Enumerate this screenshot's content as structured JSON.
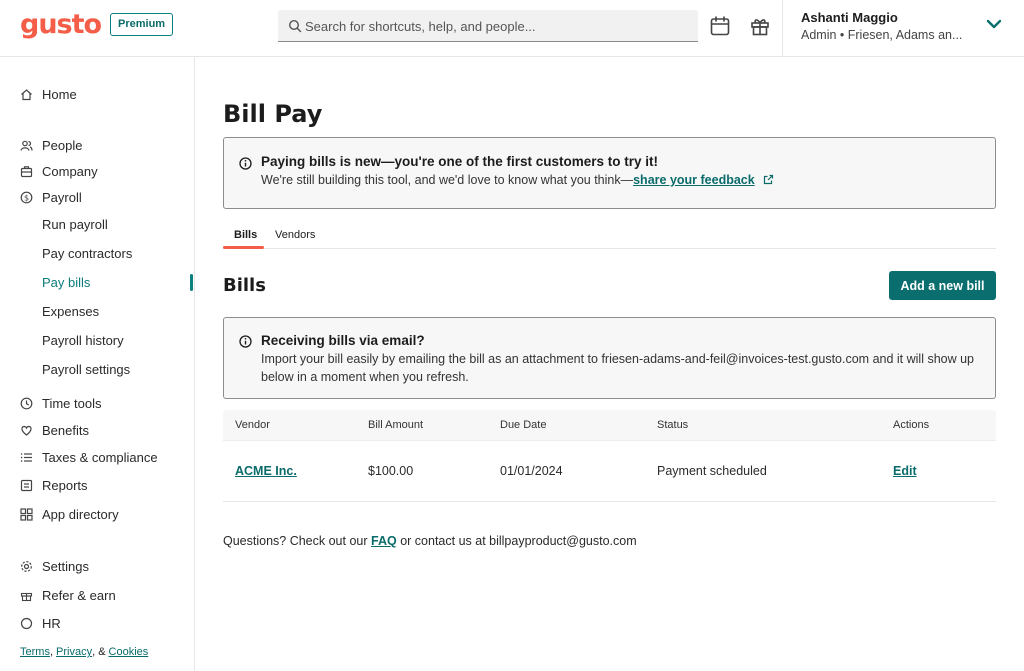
{
  "brand": {
    "logo": "gusto",
    "badge": "Premium",
    "accent": "#f45d48",
    "teal": "#0a6e6e"
  },
  "search": {
    "placeholder": "Search for shortcuts, help, and people..."
  },
  "header_icons": [
    "calendar-icon",
    "gift-icon"
  ],
  "user": {
    "name": "Ashanti Maggio",
    "role": "Admin • Friesen, Adams an..."
  },
  "sidebar": {
    "home": "Home",
    "people": "People",
    "company": "Company",
    "payroll": "Payroll",
    "payroll_sub": [
      "Run payroll",
      "Pay contractors",
      "Pay bills",
      "Expenses",
      "Payroll history",
      "Payroll settings"
    ],
    "active_item": "Pay bills",
    "time_tools": "Time tools",
    "benefits": "Benefits",
    "taxes": "Taxes & compliance",
    "reports": "Reports",
    "app_directory": "App directory",
    "settings": "Settings",
    "refer": "Refer & earn",
    "hr": "HR",
    "footer": {
      "terms": "Terms",
      "sep1": ",",
      "privacy": "Privacy",
      "sep2": ", &",
      "cookies": "Cookies"
    }
  },
  "page": {
    "title": "Bill Pay",
    "notice1": {
      "title": "Paying bills is new—you're one of the first customers to try it!",
      "body": "We're still building this tool, and we'd love to know what you think—",
      "link": "share your feedback"
    },
    "tabs": [
      "Bills",
      "Vendors"
    ],
    "section_title": "Bills",
    "add_button": "Add a new bill",
    "notice2": {
      "title": "Receiving bills via email?",
      "body": "Import your bill easily by emailing the bill as an attachment to friesen-adams-and-feil@invoices-test.gusto.com and it will show up below in a moment when you refresh."
    },
    "table": {
      "headers": [
        "Vendor",
        "Bill Amount",
        "Due Date",
        "Status",
        "Actions"
      ],
      "rows": [
        {
          "vendor": "ACME Inc.",
          "amount": "$100.00",
          "due": "01/01/2024",
          "status": "Payment scheduled",
          "action": "Edit"
        }
      ]
    },
    "footer": {
      "pre": "Questions? Check out our",
      "faq": "FAQ",
      "post": "or contact us at billpayproduct@gusto.com"
    }
  }
}
